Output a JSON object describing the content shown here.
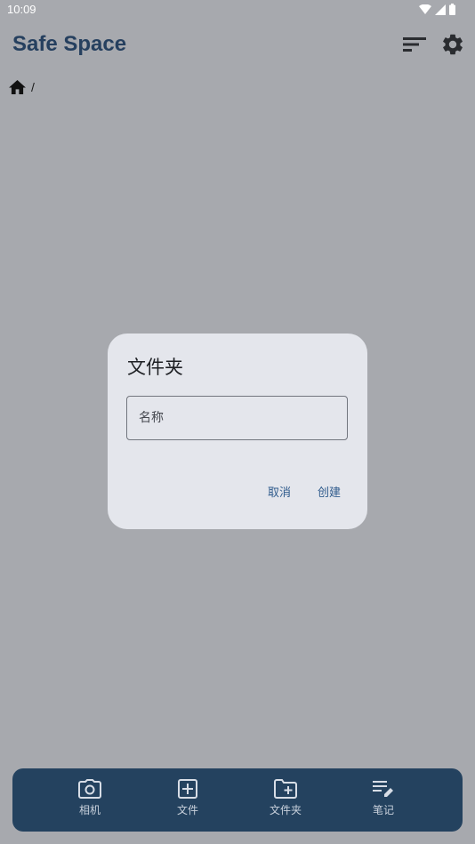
{
  "status": {
    "time": "10:09"
  },
  "app": {
    "title": "Safe Space"
  },
  "icons": {
    "sort": "sort-icon",
    "settings": "gear-icon",
    "home": "home-icon",
    "camera": "camera-icon",
    "add_file": "add-box-icon",
    "add_folder": "create-folder-icon",
    "note": "edit-note-icon"
  },
  "breadcrumb": {
    "separator": "/"
  },
  "dialog": {
    "title": "文件夹",
    "name_placeholder": "名称",
    "name_value": "",
    "cancel_label": "取消",
    "create_label": "创建"
  },
  "bottom_nav": {
    "items": [
      {
        "label": "相机"
      },
      {
        "label": "文件"
      },
      {
        "label": "文件夹"
      },
      {
        "label": "笔记"
      }
    ]
  },
  "colors": {
    "accent": "#26405f",
    "nav_background": "#24425f",
    "scrim": "#a7a9ae",
    "dialog_surface": "#e4e6ec",
    "button_text": "#2f5b8c"
  }
}
